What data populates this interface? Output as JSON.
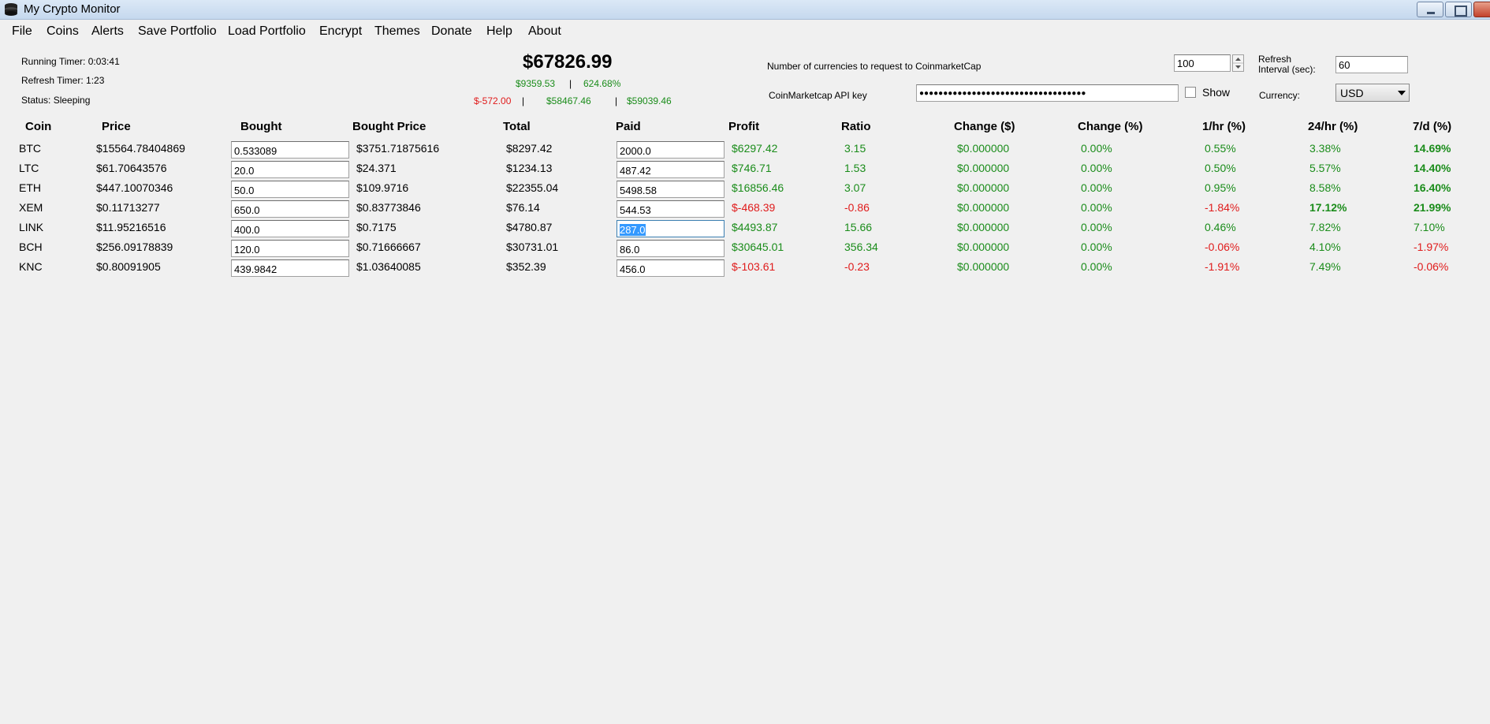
{
  "window": {
    "title": "My Crypto Monitor"
  },
  "menu": [
    "File",
    "Coins",
    "Alerts",
    "Save Portfolio",
    "Load Portfolio",
    "Encrypt",
    "Themes",
    "Donate",
    "Help",
    "About"
  ],
  "status": {
    "running_timer": "Running Timer: 0:03:41",
    "refresh_timer": "Refresh Timer: 1:23",
    "status": "Status: Sleeping"
  },
  "summary": {
    "total": "$67826.99",
    "gain_value": "$9359.53",
    "sep1": "|",
    "gain_pct": "624.68%",
    "change_neg": "$-572.00",
    "sep2": "|",
    "value_a": "$58467.46",
    "sep3": "|",
    "value_b": "$59039.46"
  },
  "settings": {
    "num_currencies_label": "Number of currencies to request to CoinmarketCap",
    "num_currencies_value": "100",
    "refresh_interval_label": "Refresh Interval (sec):",
    "refresh_interval_value": "60",
    "api_key_label": "CoinMarketcap API key",
    "api_key_masked": "●●●●●●●●●●●●●●●●●●●●●●●●●●●●●●●●●●●",
    "show_label": "Show",
    "currency_label": "Currency:",
    "currency_value": "USD"
  },
  "table": {
    "columns": [
      "Coin",
      "Price",
      "Bought",
      "Bought Price",
      "Total",
      "Paid",
      "Profit",
      "Ratio",
      "Change ($)",
      "Change (%)",
      "1/hr (%)",
      "24/hr (%)",
      "7/d (%)"
    ],
    "rows": [
      {
        "coin": "BTC",
        "price": "$15564.78404869",
        "bought": "0.533089",
        "bought_price": "$3751.71875616",
        "total": "$8297.42",
        "paid": "2000.0",
        "profit": "$6297.42",
        "ratio": "3.15",
        "change_usd": "$0.000000",
        "change_pct": "0.00%",
        "hr1": "0.55%",
        "hr24": "3.38%",
        "d7": "14.69%"
      },
      {
        "coin": "LTC",
        "price": "$61.70643576",
        "bought": "20.0",
        "bought_price": "$24.371",
        "total": "$1234.13",
        "paid": "487.42",
        "profit": "$746.71",
        "ratio": "1.53",
        "change_usd": "$0.000000",
        "change_pct": "0.00%",
        "hr1": "0.50%",
        "hr24": "5.57%",
        "d7": "14.40%"
      },
      {
        "coin": "ETH",
        "price": "$447.10070346",
        "bought": "50.0",
        "bought_price": "$109.9716",
        "total": "$22355.04",
        "paid": "5498.58",
        "profit": "$16856.46",
        "ratio": "3.07",
        "change_usd": "$0.000000",
        "change_pct": "0.00%",
        "hr1": "0.95%",
        "hr24": "8.58%",
        "d7": "16.40%"
      },
      {
        "coin": "XEM",
        "price": "$0.11713277",
        "bought": "650.0",
        "bought_price": "$0.83773846",
        "total": "$76.14",
        "paid": "544.53",
        "profit": "$-468.39",
        "ratio": "-0.86",
        "change_usd": "$0.000000",
        "change_pct": "0.00%",
        "hr1": "-1.84%",
        "hr24": "17.12%",
        "d7": "21.99%"
      },
      {
        "coin": "LINK",
        "price": "$11.95216516",
        "bought": "400.0",
        "bought_price": "$0.7175",
        "total": "$4780.87",
        "paid": "287.0",
        "profit": "$4493.87",
        "ratio": "15.66",
        "change_usd": "$0.000000",
        "change_pct": "0.00%",
        "hr1": "0.46%",
        "hr24": "7.82%",
        "d7": "7.10%"
      },
      {
        "coin": "BCH",
        "price": "$256.09178839",
        "bought": "120.0",
        "bought_price": "$0.71666667",
        "total": "$30731.01",
        "paid": "86.0",
        "profit": "$30645.01",
        "ratio": "356.34",
        "change_usd": "$0.000000",
        "change_pct": "0.00%",
        "hr1": "-0.06%",
        "hr24": "4.10%",
        "d7": "-1.97%"
      },
      {
        "coin": "KNC",
        "price": "$0.80091905",
        "bought": "439.9842",
        "bought_price": "$1.03640085",
        "total": "$352.39",
        "paid": "456.0",
        "profit": "$-103.61",
        "ratio": "-0.23",
        "change_usd": "$0.000000",
        "change_pct": "0.00%",
        "hr1": "-1.91%",
        "hr24": "7.49%",
        "d7": "-0.06%"
      }
    ]
  },
  "colors": {
    "positive": "#1a8c1a",
    "negative": "#e01b1b",
    "selection": "#3399ff"
  }
}
